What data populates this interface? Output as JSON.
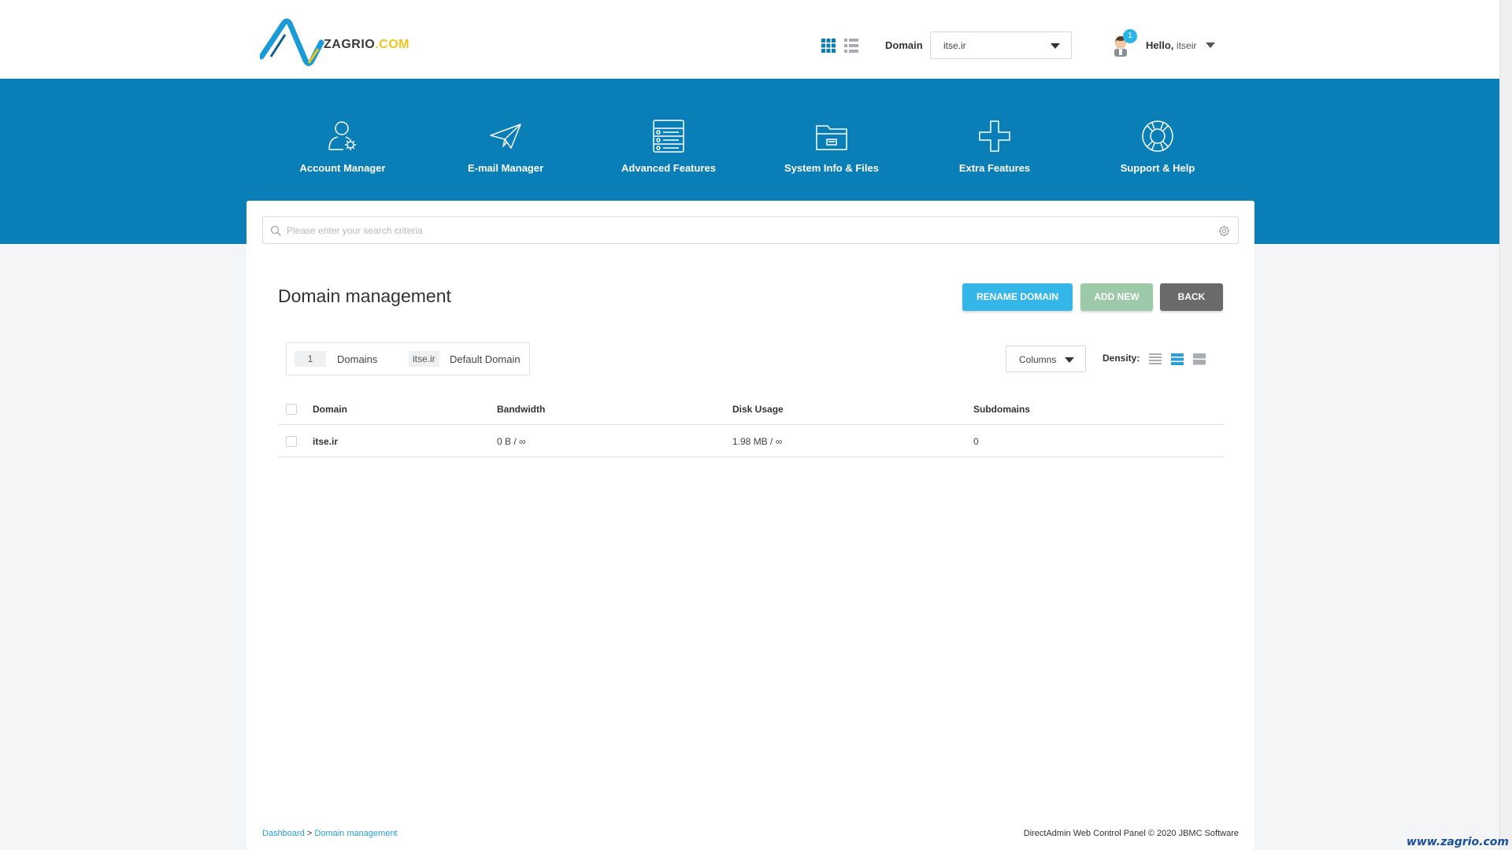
{
  "header": {
    "logo_text_main": "ZAGRIO",
    "logo_text_tld": ".COM",
    "domain_label": "Domain",
    "domain_selected": "itse.ir",
    "notification_count": "1",
    "hello_prefix": "Hello,",
    "username": "itseir"
  },
  "nav": {
    "items": [
      {
        "label": "Account Manager",
        "icon": "account-manager-icon"
      },
      {
        "label": "E-mail Manager",
        "icon": "paper-plane-icon"
      },
      {
        "label": "Advanced Features",
        "icon": "server-icon"
      },
      {
        "label": "System Info & Files",
        "icon": "folder-icon"
      },
      {
        "label": "Extra Features",
        "icon": "plus-icon"
      },
      {
        "label": "Support & Help",
        "icon": "lifebuoy-icon"
      }
    ]
  },
  "search": {
    "placeholder": "Please enter your search criteria"
  },
  "page": {
    "title": "Domain management",
    "buttons": {
      "rename": "RENAME DOMAIN",
      "add": "ADD NEW",
      "back": "BACK"
    }
  },
  "summary": {
    "count": "1",
    "count_label": "Domains",
    "default_domain": "itse.ir",
    "default_label": "Default Domain"
  },
  "toolbar": {
    "columns_label": "Columns",
    "density_label": "Density:"
  },
  "table": {
    "headers": [
      "Domain",
      "Bandwidth",
      "Disk Usage",
      "Subdomains"
    ],
    "rows": [
      {
        "domain": "itse.ir",
        "bandwidth": "0 B / ∞",
        "disk": "1.98 MB / ∞",
        "subdomains": "0"
      }
    ]
  },
  "footer": {
    "breadcrumb_home": "Dashboard",
    "breadcrumb_sep": ">",
    "breadcrumb_current": "Domain management",
    "copyright": "DirectAdmin Web Control Panel © 2020 JBMC Software"
  },
  "watermark": "www.zagrio.com",
  "colors": {
    "nav_bg": "#0a7eb6",
    "rename_button": "#35b6e8",
    "add_button": "#9ccaa9",
    "back_button": "#6a6a6a",
    "link": "#2a9fd6"
  }
}
